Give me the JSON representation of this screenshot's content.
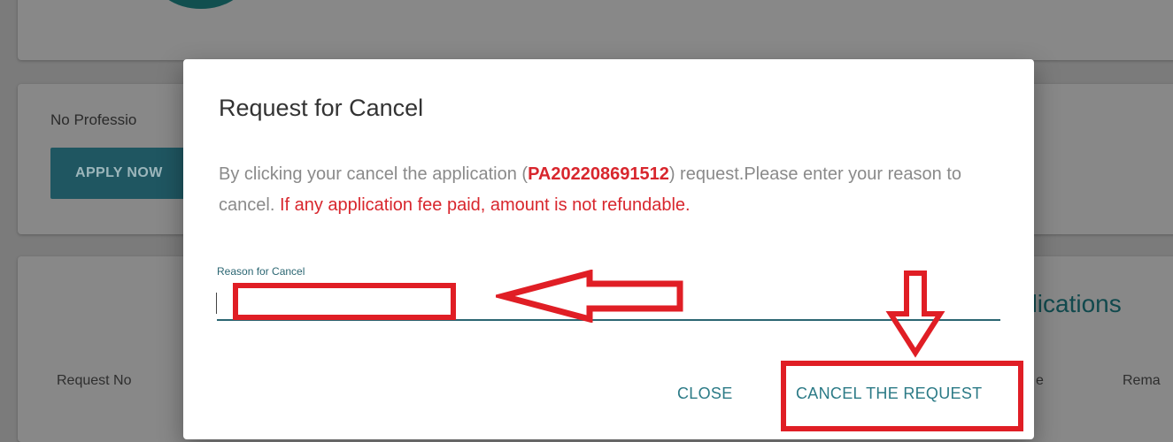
{
  "background": {
    "no_professional_text": "No Professio",
    "apply_now_label": "APPLY NOW",
    "applications_title": "plications",
    "col_request_no": "Request No",
    "col_e": "e",
    "col_rema": "Rema"
  },
  "modal": {
    "title": "Request for Cancel",
    "body_prefix": "By clicking your cancel the application (",
    "application_code": "PA202208691512",
    "body_middle": ") request.Please enter your reason to cancel. ",
    "warning": "If any application fee paid, amount is not refundable.",
    "reason_label": "Reason for Cancel",
    "reason_value": "",
    "close_label": "CLOSE",
    "cancel_request_label": "CANCEL THE REQUEST"
  },
  "colors": {
    "accent": "#2b7a86",
    "warning_red": "#d8262d",
    "annotation_red": "#e01e25"
  }
}
